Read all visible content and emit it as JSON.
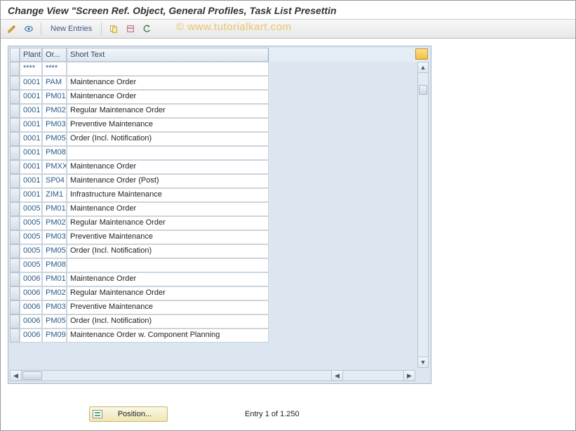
{
  "title": "Change View \"Screen Ref. Object, General Profiles, Task List Presettin",
  "watermark": "© www.tutorialkart.com",
  "toolbar": {
    "new_entries": "New Entries"
  },
  "columns": {
    "plant": "Plant",
    "order": "Or...",
    "short_text": "Short Text"
  },
  "rows": [
    {
      "plant": "****",
      "order": "****",
      "text": ""
    },
    {
      "plant": "0001",
      "order": "PAM",
      "text": "Maintenance Order"
    },
    {
      "plant": "0001",
      "order": "PM01",
      "text": "Maintenance Order"
    },
    {
      "plant": "0001",
      "order": "PM02",
      "text": "Regular Maintenance Order"
    },
    {
      "plant": "0001",
      "order": "PM03",
      "text": "Preventive Maintenance"
    },
    {
      "plant": "0001",
      "order": "PM05",
      "text": "Order (Incl. Notification)"
    },
    {
      "plant": "0001",
      "order": "PM08",
      "text": ""
    },
    {
      "plant": "0001",
      "order": "PMXX",
      "text": "Maintenance Order"
    },
    {
      "plant": "0001",
      "order": "SP04",
      "text": "Maintenance Order (Post)"
    },
    {
      "plant": "0001",
      "order": "ZIM1",
      "text": "Infrastructure Maintenance"
    },
    {
      "plant": "0005",
      "order": "PM01",
      "text": "Maintenance Order"
    },
    {
      "plant": "0005",
      "order": "PM02",
      "text": "Regular Maintenance Order"
    },
    {
      "plant": "0005",
      "order": "PM03",
      "text": "Preventive Maintenance"
    },
    {
      "plant": "0005",
      "order": "PM05",
      "text": "Order (Incl. Notification)"
    },
    {
      "plant": "0005",
      "order": "PM08",
      "text": ""
    },
    {
      "plant": "0006",
      "order": "PM01",
      "text": "Maintenance Order"
    },
    {
      "plant": "0006",
      "order": "PM02",
      "text": "Regular Maintenance Order"
    },
    {
      "plant": "0006",
      "order": "PM03",
      "text": "Preventive Maintenance"
    },
    {
      "plant": "0006",
      "order": "PM05",
      "text": "Order (Incl. Notification)"
    },
    {
      "plant": "0006",
      "order": "PM09",
      "text": "Maintenance Order w. Component Planning"
    }
  ],
  "footer": {
    "position_label": "Position...",
    "entry_text": "Entry 1 of 1.250"
  }
}
